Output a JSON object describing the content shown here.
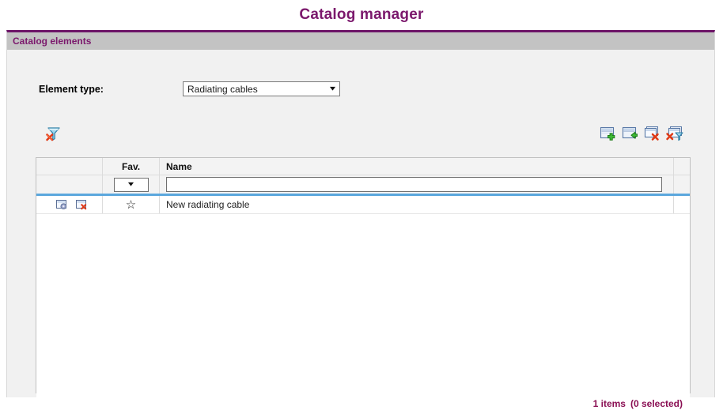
{
  "page": {
    "title": "Catalog manager",
    "accent_purple": "#7b186c",
    "header_bar_bg": "#c3c3c3",
    "body_bg": "#f1f1f1"
  },
  "panel": {
    "header_title": "Catalog elements"
  },
  "form": {
    "element_type_label": "Element type:",
    "element_type_value": "Radiating cables",
    "element_type_options": [
      "Radiating cables"
    ]
  },
  "toolbar": {
    "left": [
      {
        "name": "clear-filter-icon",
        "title": "Clear filter"
      }
    ],
    "right": [
      {
        "name": "add-element-icon",
        "title": "Add element"
      },
      {
        "name": "import-element-icon",
        "title": "Import element"
      },
      {
        "name": "delete-element-icon",
        "title": "Delete element"
      },
      {
        "name": "delete-filtered-elements-icon",
        "title": "Delete filtered elements"
      }
    ]
  },
  "grid": {
    "columns": [
      {
        "key": "actions",
        "label": ""
      },
      {
        "key": "fav",
        "label": "Fav."
      },
      {
        "key": "name",
        "label": "Name"
      }
    ],
    "filters": {
      "fav_value": "",
      "name_value": "",
      "name_placeholder": ""
    },
    "rows": [
      {
        "fav": "☆",
        "name": "New radiating cable",
        "edit_icon": "edit-row-icon",
        "delete_icon": "delete-row-icon"
      }
    ],
    "footer": {
      "items_text": "1 items",
      "selected_text": "(0 selected)",
      "color": "#8a0f53"
    }
  }
}
